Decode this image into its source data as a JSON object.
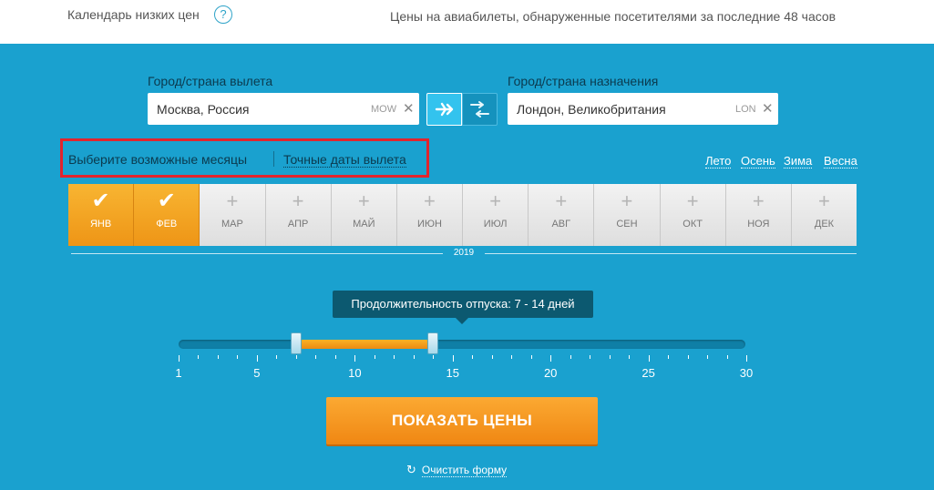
{
  "header": {
    "title": "Календарь низких цен",
    "help_icon": "?",
    "subtitle": "Цены на авиабилеты, обнаруженные посетителями за последние 48 часов"
  },
  "form": {
    "origin": {
      "label": "Город/страна вылета",
      "value": "Москва, Россия",
      "code": "MOW"
    },
    "destination": {
      "label": "Город/страна назначения",
      "value": "Лондон, Великобритания",
      "code": "LON"
    },
    "toggle": {
      "oneway_icon": "plane-icon",
      "roundtrip_icon": "roundtrip-icon",
      "active": "oneway"
    }
  },
  "mode": {
    "months_label": "Выберите возможные месяцы",
    "dates_label": "Точные даты вылета"
  },
  "seasons": [
    "Лето",
    "Осень",
    "Зима",
    "Весна"
  ],
  "months": [
    {
      "label": "ЯНВ",
      "selected": true
    },
    {
      "label": "ФЕВ",
      "selected": true
    },
    {
      "label": "МАР",
      "selected": false
    },
    {
      "label": "АПР",
      "selected": false
    },
    {
      "label": "МАЙ",
      "selected": false
    },
    {
      "label": "ИЮН",
      "selected": false
    },
    {
      "label": "ИЮЛ",
      "selected": false
    },
    {
      "label": "АВГ",
      "selected": false
    },
    {
      "label": "СЕН",
      "selected": false
    },
    {
      "label": "ОКТ",
      "selected": false
    },
    {
      "label": "НОЯ",
      "selected": false
    },
    {
      "label": "ДЕК",
      "selected": false
    }
  ],
  "year": "2019",
  "duration": {
    "tooltip": "Продолжительность отпуска: 7 - 14 дней",
    "min": 1,
    "max": 30,
    "from": 7,
    "to": 14,
    "ticks": [
      "1",
      "5",
      "10",
      "15",
      "20",
      "25",
      "30"
    ]
  },
  "actions": {
    "show_prices": "ПОКАЗАТЬ ЦЕНЫ",
    "clear_form": "Очистить форму"
  },
  "colors": {
    "background": "#1aa1cf",
    "accent_orange": "#f39a1e",
    "highlight_red": "#e2242d"
  }
}
